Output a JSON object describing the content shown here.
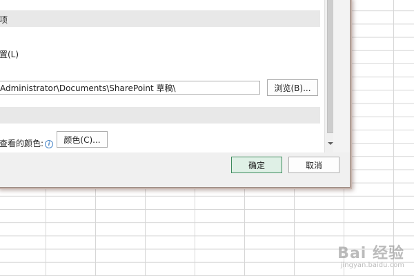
{
  "dialog": {
    "section1_header": "项",
    "setting_label": "置(L)",
    "path_value": "Administrator\\Documents\\SharePoint 草稿\\",
    "browse_button": "浏览(B)...",
    "color_label": "查看的颜色:",
    "color_button": "颜色(C)...",
    "ok_button": "确定",
    "cancel_button": "取消"
  },
  "icons": {
    "info": "info-icon",
    "scroll_down": "scroll-down-arrow"
  },
  "watermark": {
    "logo": "Bai 经验",
    "url": "jingyan.baidu.com"
  },
  "colors": {
    "ok_border": "#3c8a5c",
    "ok_fill": "#dff0e6",
    "dialog_shadow": "#c8b6ae",
    "grid": "#d6d6d6"
  }
}
